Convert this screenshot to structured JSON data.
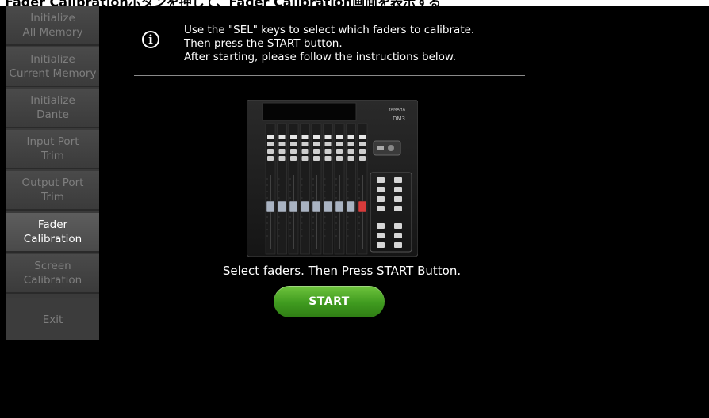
{
  "banner": {
    "text": "Fader Calibrationボタンを押して、Fader Calibration画面を表示する"
  },
  "sidebar": {
    "items": [
      {
        "label": "Initialize\nAll Memory",
        "active": false
      },
      {
        "label": "Initialize\nCurrent Memory",
        "active": false
      },
      {
        "label": "Initialize\nDante",
        "active": false
      },
      {
        "label": "Input Port\nTrim",
        "active": false
      },
      {
        "label": "Output Port\nTrim",
        "active": false
      },
      {
        "label": "Fader\nCalibration",
        "active": true
      },
      {
        "label": "Screen\nCalibration",
        "active": false
      },
      {
        "label": "Exit",
        "active": false
      }
    ]
  },
  "main": {
    "info_icon": "info-icon",
    "instructions": "Use the \"SEL\" keys to select which faders to calibrate.\nThen press the START button.\nAfter starting, please follow the instructions below.",
    "console_brand": "YAMAHA",
    "console_model": "DM3",
    "prompt": "Select faders. Then Press START Button.",
    "start_label": "START"
  },
  "colors": {
    "accent": "#4aa826",
    "active_text": "#ffffff",
    "inactive_text": "#7e7e7e"
  }
}
